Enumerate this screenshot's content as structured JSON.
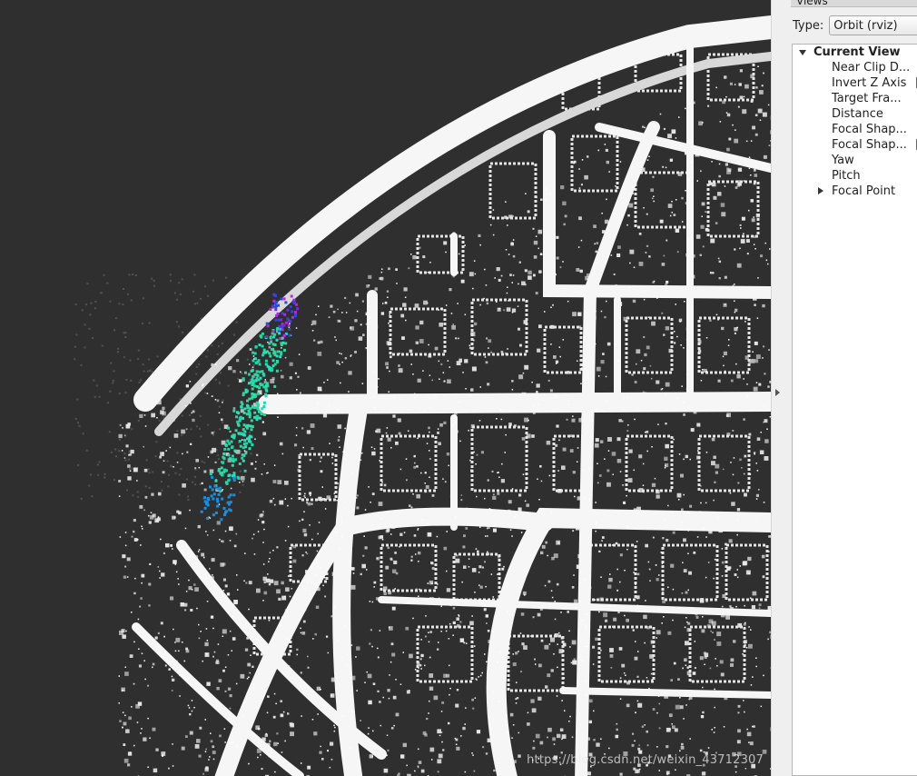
{
  "viewport": {
    "watermark": "https://blog.csdn.net/weixin_43712307"
  },
  "views_panel": {
    "header_title": "Views",
    "type_label": "Type:",
    "type_value": "Orbit (rviz)",
    "tree": {
      "root_label": "Current View",
      "items": [
        {
          "label": "Near Clip D..."
        },
        {
          "label": "Invert Z Axis"
        },
        {
          "label": "Target Fra..."
        },
        {
          "label": "Distance"
        },
        {
          "label": "Focal Shap..."
        },
        {
          "label": "Focal Shap..."
        },
        {
          "label": "Yaw"
        },
        {
          "label": "Pitch"
        },
        {
          "label": "Focal Point"
        }
      ]
    }
  },
  "colors": {
    "background": "#2f2f2f",
    "map_points": "#f2f2f2",
    "scan_colors": [
      "#1dd6a8",
      "#26e2b9",
      "#3bd19a",
      "#1a8fe0",
      "#2a4bd6",
      "#7b2ad6",
      "#b52ae0"
    ]
  }
}
